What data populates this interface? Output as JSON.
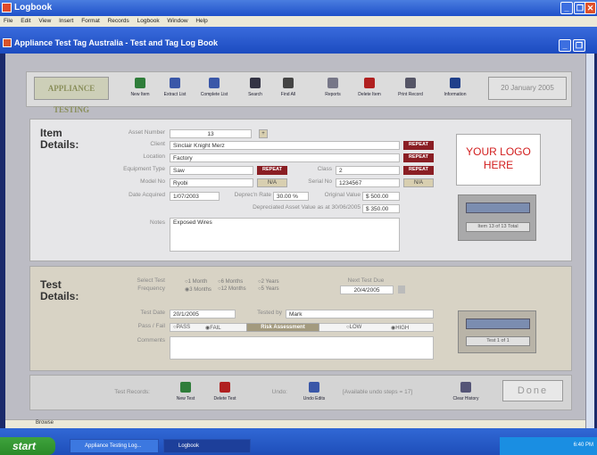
{
  "app": {
    "title": "Logbook"
  },
  "menu": [
    "File",
    "Edit",
    "View",
    "Insert",
    "Format",
    "Records",
    "Logbook",
    "Window",
    "Help"
  ],
  "document": {
    "title": "Appliance Test Tag Australia - Test and Tag Log Book"
  },
  "toolbar": {
    "logo_text": "APPLIANCE TESTING",
    "buttons": [
      {
        "label": "New Item",
        "icon": "new-item-icon",
        "color": "#2f7d3a"
      },
      {
        "label": "Extract List",
        "icon": "extract-list-icon",
        "color": "#3a57a8"
      },
      {
        "label": "Complete List",
        "icon": "complete-list-icon",
        "color": "#3a57a8"
      },
      {
        "label": "Search",
        "icon": "search-icon",
        "color": "#334"
      },
      {
        "label": "Find All",
        "icon": "find-all-icon",
        "color": "#444"
      },
      {
        "label": "Reports",
        "icon": "reports-icon",
        "color": "#778"
      },
      {
        "label": "Delete Item",
        "icon": "delete-item-icon",
        "color": "#b02020"
      },
      {
        "label": "Print Record",
        "icon": "print-icon",
        "color": "#556"
      },
      {
        "label": "Information",
        "icon": "info-icon",
        "color": "#1f3f8a"
      }
    ],
    "date": "20 January 2005"
  },
  "item": {
    "title_line1": "Item",
    "title_line2": "Details:",
    "asset_number_label": "Asset Number",
    "asset_number": "13",
    "client_label": "Client",
    "client": "Sinclair Knight Merz",
    "location_label": "Location",
    "location": "Factory",
    "equipment_type_label": "Equipment Type",
    "equipment_type": "Saw",
    "class_label": "Class",
    "class": "2",
    "model_label": "Model No",
    "model": "Ryobi",
    "serial_label": "Serial No",
    "serial": "1234567",
    "na": "N/A",
    "date_acquired_label": "Date Acquired",
    "date_acquired": "1/07/2003",
    "deprec_rate_label": "Deprec'n Rate",
    "deprec_rate": "30.00 %",
    "original_value_label": "Original Value",
    "original_value": "$ 500.00",
    "depreciated_label": "Depreciated Asset Value as at 30/06/2005",
    "depreciated_value": "$ 350.00",
    "notes_label": "Notes",
    "notes": "Exposed Wires",
    "repeat": "REPEAT",
    "logo_placeholder_line1": "YOUR LOGO",
    "logo_placeholder_line2": "HERE",
    "record_caption": "Item 13 of 13 Total"
  },
  "test": {
    "title_line1": "Test",
    "title_line2": "Details:",
    "frequency_label_line1": "Select Test",
    "frequency_label_line2": "Frequency",
    "freq_options": [
      "1 Month",
      "6 Months",
      "2 Years",
      "3 Months",
      "12 Months",
      "5 Years"
    ],
    "freq_selected": "3 Months",
    "next_test_due_label": "Next Test Due",
    "next_test_due": "20/4/2005",
    "test_date_label": "Test Date",
    "test_date": "20/1/2005",
    "tested_by_label": "Tested by",
    "tested_by": "Mark",
    "pass_fail_label": "Pass / Fail",
    "pass_option": "PASS",
    "fail_option": "FAIL",
    "result": "FAIL",
    "risk_button": "Risk Assessment",
    "low_option": "LOW",
    "high_option": "HIGH",
    "risk": "HIGH",
    "comments_label": "Comments",
    "comments": "",
    "record_caption": "Test 1 of 1"
  },
  "bottom": {
    "test_records_label": "Test Records:",
    "new_test": "New Test",
    "delete_test": "Delete Test",
    "undo_label": "Undo:",
    "undo_edits": "Undo Edits",
    "undo_steps": "[Available undo steps = 17]",
    "clear_history": "Clear History",
    "done": "Done"
  },
  "statusbar": {
    "text": "Browse"
  },
  "taskbar": {
    "start": "start",
    "tasks": [
      "Appliance Testing Log...",
      "Logbook"
    ],
    "clock": "6:40 PM"
  }
}
